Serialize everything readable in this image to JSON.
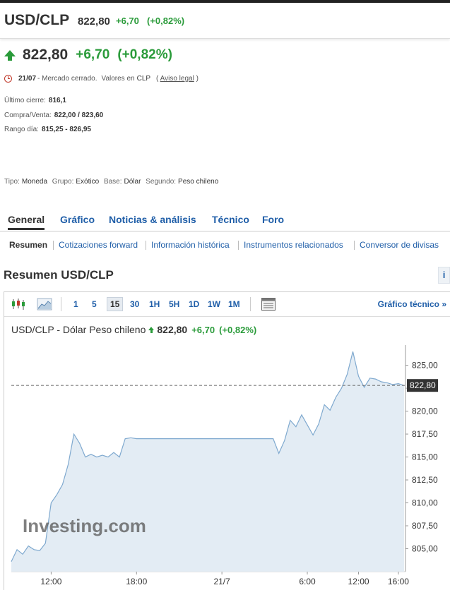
{
  "header": {
    "pair": "USD/CLP",
    "price": "822,80",
    "change": "+6,70",
    "change_pct": "(+0,82%)"
  },
  "quote": {
    "price": "822,80",
    "change": "+6,70",
    "change_pct": "(+0,82%)",
    "date": "21/07",
    "status": "- Mercado cerrado.",
    "currency_note": "Valores en",
    "currency": "CLP",
    "legal_open": "(",
    "legal_link": "Aviso legal",
    "legal_close": ")"
  },
  "details": {
    "last_close_label": "Último cierre:",
    "last_close": "816,1",
    "bid_ask_label": "Compra/Venta:",
    "bid_ask": "822,00 / 823,60",
    "day_range_label": "Rango día:",
    "day_range": "815,25 - 826,95"
  },
  "meta": {
    "type_label": "Tipo:",
    "type": "Moneda",
    "group_label": "Grupo:",
    "group": "Exótico",
    "base_label": "Base:",
    "base": "Dólar",
    "second_label": "Segundo:",
    "second": "Peso chileno"
  },
  "tabs": [
    "General",
    "Gráfico",
    "Noticias & análisis",
    "Técnico",
    "Foro"
  ],
  "subnav": [
    "Resumen",
    "Cotizaciones forward",
    "Información histórica",
    "Instrumentos relacionados",
    "Conversor de divisas"
  ],
  "section_title": "Resumen USD/CLP",
  "info_label": "i",
  "toolbar": {
    "icons": [
      "candlestick-icon",
      "area-chart-icon",
      "table-icon"
    ],
    "timeframes": [
      "1",
      "5",
      "15",
      "30",
      "1H",
      "5H",
      "1D",
      "1W",
      "1M"
    ],
    "active_timeframe": "15",
    "tech_link": "Gráfico técnico »"
  },
  "chart_head": {
    "name": "USD/CLP - Dólar Peso chileno",
    "price": "822,80",
    "change": "+6,70",
    "change_pct": "(+0,82%)"
  },
  "watermark": "Investing.com",
  "colors": {
    "up": "#2a9b3a",
    "link": "#1f5ea8",
    "line": "#7fa9cf",
    "fill": "#e3ecf4"
  },
  "chart_data": {
    "type": "area",
    "x_labels": [
      "12:00",
      "18:00",
      "21/7",
      "6:00",
      "12:00",
      "16:00"
    ],
    "y_ticks": [
      805,
      807.5,
      810,
      812.5,
      815,
      817.5,
      820,
      822.5,
      825
    ],
    "y_tick_labels": [
      "805,00",
      "807,50",
      "810,00",
      "812,50",
      "815,00",
      "817,50",
      "820,00",
      "",
      "825,00"
    ],
    "ylim": [
      802.5,
      827.2
    ],
    "last_value": 822.8,
    "last_value_label": "822,80",
    "values": [
      803.6,
      804.9,
      804.4,
      805.3,
      804.9,
      804.8,
      805.6,
      810.0,
      810.9,
      812.0,
      814.2,
      817.5,
      816.5,
      815.0,
      815.3,
      815.0,
      815.2,
      815.0,
      815.5,
      815.0,
      817.0,
      817.1,
      817.0,
      817.0,
      817.0,
      817.0,
      817.0,
      817.0,
      817.0,
      817.0,
      817.0,
      817.0,
      817.0,
      817.0,
      817.0,
      817.0,
      817.0,
      817.0,
      817.0,
      817.0,
      817.0,
      817.0,
      817.0,
      817.0,
      817.0,
      817.0,
      817.0,
      815.4,
      816.8,
      819.0,
      818.3,
      819.6,
      818.5,
      817.4,
      818.6,
      820.7,
      820.1,
      821.5,
      822.5,
      824.0,
      826.5,
      823.8,
      822.6,
      823.6,
      823.5,
      823.2,
      823.1,
      822.9,
      823.0,
      822.8
    ]
  }
}
